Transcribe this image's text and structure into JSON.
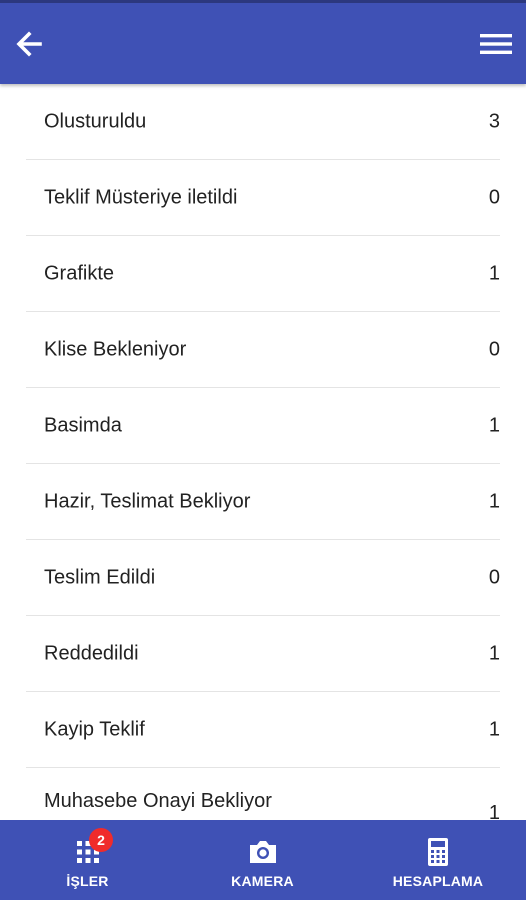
{
  "app_bar": {
    "back_icon": "arrow-left-icon",
    "menu_icon": "hamburger-menu-icon",
    "background_color": "#3f51b5"
  },
  "statuses": [
    {
      "label": "Olusturuldu",
      "count": "3"
    },
    {
      "label": "Teklif Müsteriye iletildi",
      "count": "0"
    },
    {
      "label": "Grafikte",
      "count": "1"
    },
    {
      "label": "Klise Bekleniyor",
      "count": "0"
    },
    {
      "label": "Basimda",
      "count": "1"
    },
    {
      "label": "Hazir, Teslimat Bekliyor",
      "count": "1"
    },
    {
      "label": "Teslim Edildi",
      "count": "0"
    },
    {
      "label": "Reddedildi",
      "count": "1"
    },
    {
      "label": "Kayip Teklif",
      "count": "1"
    },
    {
      "label": "Muhasebe Onayi Bekliyor",
      "count": "1"
    }
  ],
  "bottom_nav": {
    "items": [
      {
        "label": "İŞLER",
        "icon": "grid-icon",
        "badge": "2"
      },
      {
        "label": "KAMERA",
        "icon": "camera-icon"
      },
      {
        "label": "HESAPLAMA",
        "icon": "calculator-icon"
      }
    ],
    "badge_color": "#f02b2b"
  }
}
